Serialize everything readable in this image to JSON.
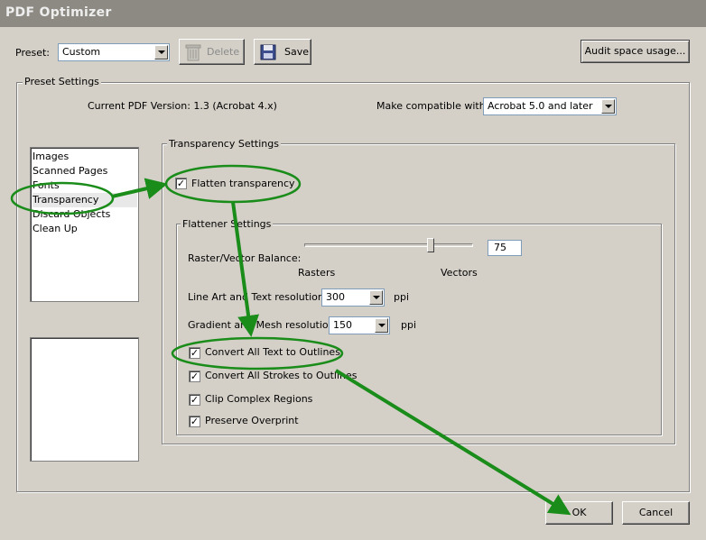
{
  "window": {
    "title": "PDF Optimizer"
  },
  "preset": {
    "label": "Preset:",
    "value": "Custom"
  },
  "toolbar": {
    "delete_label": "Delete",
    "save_label": "Save",
    "audit_label": "Audit space usage..."
  },
  "preset_settings": {
    "legend": "Preset Settings",
    "pdf_version": "Current PDF Version: 1.3 (Acrobat 4.x)",
    "compat_label": "Make compatible with:",
    "compat_value": "Acrobat 5.0 and later"
  },
  "categories": [
    "Images",
    "Scanned Pages",
    "Fonts",
    "Transparency",
    "Discard Objects",
    "Clean Up"
  ],
  "transparency": {
    "legend": "Transparency Settings",
    "flatten_label": "Flatten transparency",
    "flatten_checked": true
  },
  "flattener": {
    "legend": "Flattener Settings",
    "balance_label": "Raster/Vector Balance:",
    "balance_value": "75",
    "rasters_label": "Rasters",
    "vectors_label": "Vectors",
    "lineart_label": "Line Art and Text resolution:",
    "lineart_value": "300",
    "lineart_unit": "ppi",
    "gradient_label": "Gradient and Mesh resolution:",
    "gradient_value": "150",
    "gradient_unit": "ppi",
    "options": [
      {
        "label": "Convert All Text to Outlines",
        "checked": true
      },
      {
        "label": "Convert All Strokes to Outlines",
        "checked": true
      },
      {
        "label": "Clip Complex Regions",
        "checked": true
      },
      {
        "label": "Preserve Overprint",
        "checked": true
      }
    ]
  },
  "footer": {
    "ok_label": "OK",
    "cancel_label": "Cancel"
  },
  "annotation_color": "#1a8c1a"
}
